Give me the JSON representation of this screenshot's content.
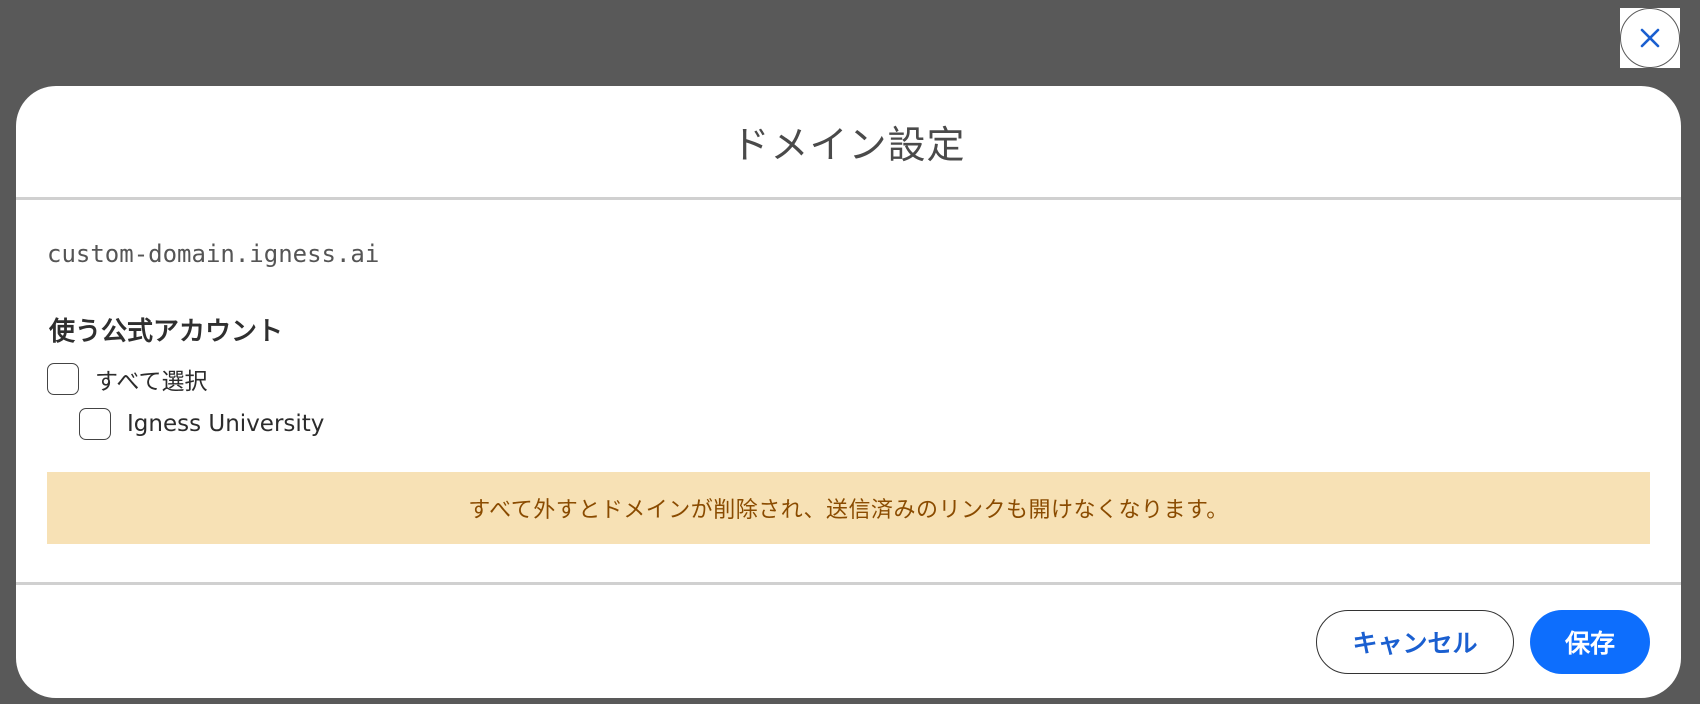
{
  "modal": {
    "title": "ドメイン設定",
    "domain": "custom-domain.igness.ai",
    "section_label": "使う公式アカウント",
    "select_all_label": "すべて選択",
    "select_all_checked": false,
    "accounts": [
      {
        "label": "Igness University",
        "checked": false
      }
    ],
    "warning_text": "すべて外すとドメインが削除され、送信済みのリンクも開けなくなります。",
    "cancel_label": "キャンセル",
    "save_label": "保存"
  },
  "icons": {
    "close": "close-icon"
  },
  "colors": {
    "overlay": "#595959",
    "accent": "#0d6efd",
    "warning_bg": "#f7e1b5",
    "warning_text": "#8a4b00",
    "cancel_text": "#1a5fd0"
  }
}
